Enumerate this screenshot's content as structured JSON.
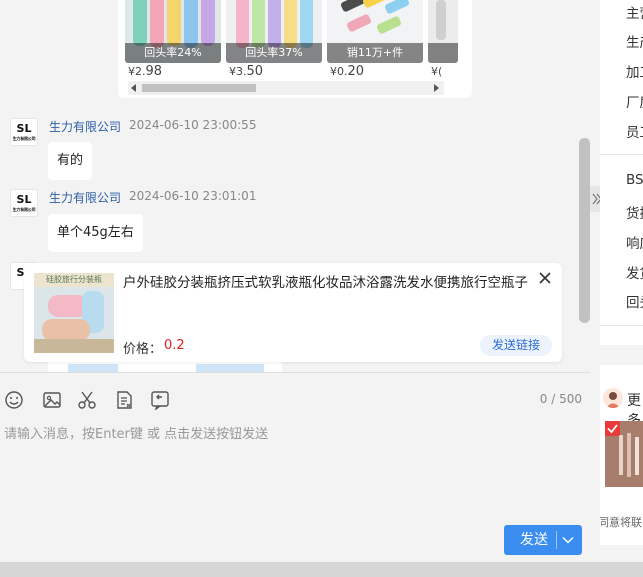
{
  "products": [
    {
      "tag": "回头率24%",
      "price_small": "¥2.",
      "price_big": "98"
    },
    {
      "tag": "回头率37%",
      "price_small": "¥3.",
      "price_big": "50"
    },
    {
      "tag": "销11万+件",
      "price_small": "¥0.",
      "price_big": "20"
    },
    {
      "tag": "",
      "price_small": "¥(",
      "price_big": ""
    }
  ],
  "messages": [
    {
      "sender": "生力有限公司",
      "time": "2024-06-10 23:00:55",
      "text": "有的"
    },
    {
      "sender": "生力有限公司",
      "time": "2024-06-10 23:01:01",
      "text": "单个45g左右"
    }
  ],
  "avatar": {
    "logo": "SL",
    "small": "生力有限公司"
  },
  "popup": {
    "image_text": "硅胶旅行分装瓶",
    "title": "户外硅胶分装瓶挤压式软乳液瓶化妆品沐浴露洗发水便携旅行空瓶子",
    "price_label": "价格：",
    "price": "0.2",
    "send_link": "发送链接"
  },
  "input": {
    "counter": "0 / 500",
    "placeholder": "请输入消息，按Enter键 或 点击发送按钮发送",
    "send": "发送"
  },
  "right_panel": {
    "top_items": [
      "主营",
      "生产",
      "加工",
      "厂房",
      "员工"
    ],
    "mid_items": [
      "BSR",
      "货描",
      "响应",
      "发货",
      "回头"
    ],
    "rec_title": "更多",
    "agree": "同意将联"
  },
  "colors": {
    "accent": "#3b8ef0",
    "link": "#2b5ea6",
    "price": "#e02020"
  }
}
